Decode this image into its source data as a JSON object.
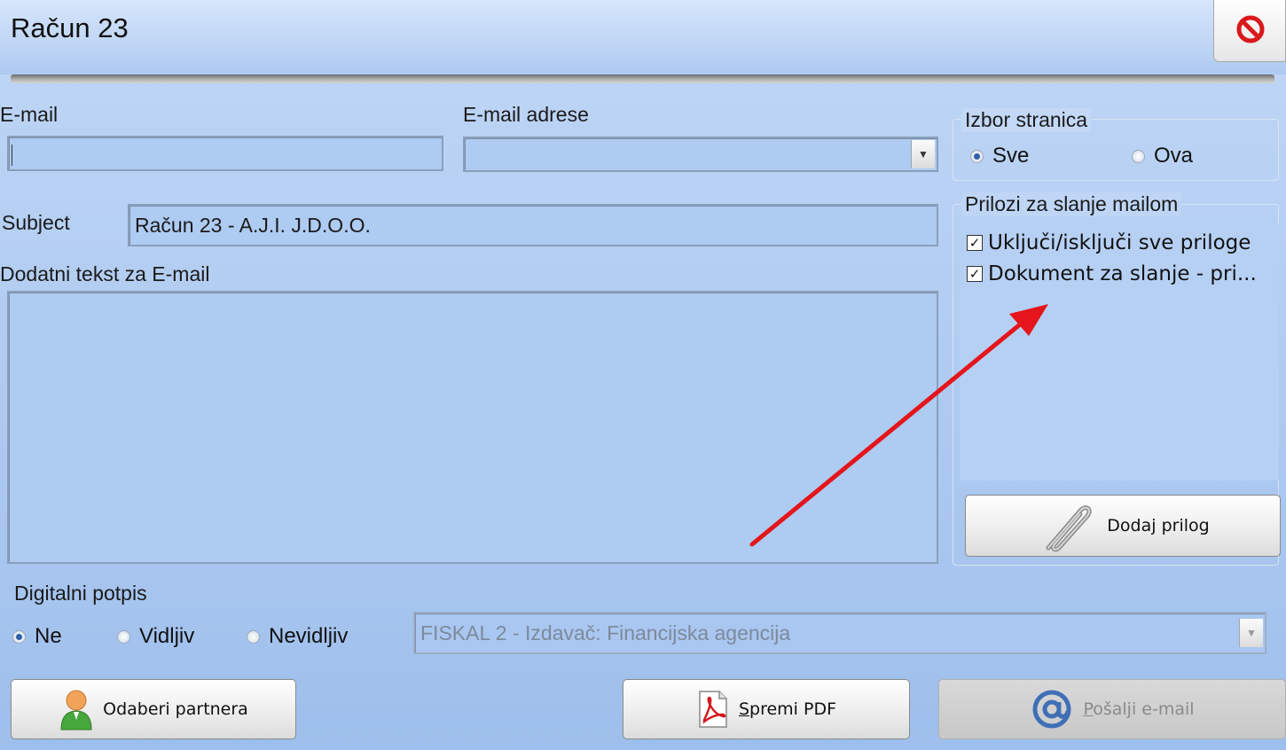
{
  "window": {
    "title": "Račun 23"
  },
  "email": {
    "label": "E-mail",
    "value": ""
  },
  "email_addresses": {
    "label": "E-mail adrese",
    "value": ""
  },
  "page_selection": {
    "title": "Izbor stranica",
    "options": [
      {
        "label": "Sve",
        "selected": true
      },
      {
        "label": "Ova",
        "selected": false
      }
    ]
  },
  "subject": {
    "label": "Subject",
    "value": "Račun 23 - A.J.I. J.D.O.O."
  },
  "additional_text": {
    "label": "Dodatni tekst za E-mail",
    "value": ""
  },
  "attachments": {
    "title": "Prilozi za slanje mailom",
    "items": [
      {
        "label": "Uključi/isključi sve priloge",
        "checked": true
      },
      {
        "label": "Dokument za slanje - pri...",
        "checked": true
      }
    ],
    "add_button": "Dodaj prilog"
  },
  "digital_signature": {
    "title": "Digitalni potpis",
    "options": [
      {
        "label": "Ne",
        "selected": true
      },
      {
        "label": "Vidljiv",
        "selected": false
      },
      {
        "label": "Nevidljiv",
        "selected": false
      }
    ],
    "certificate": "FISKAL 2 - Izdavač: Financijska agencija"
  },
  "buttons": {
    "choose_partner": "Odaberi partnera",
    "save_pdf_underlined": "S",
    "save_pdf_rest": "premi PDF",
    "send_email_underlined": "P",
    "send_email_rest": "ošalji e-mail"
  },
  "colors": {
    "annotation_arrow": "#e4161b",
    "window_bg": "#aecaf1"
  }
}
